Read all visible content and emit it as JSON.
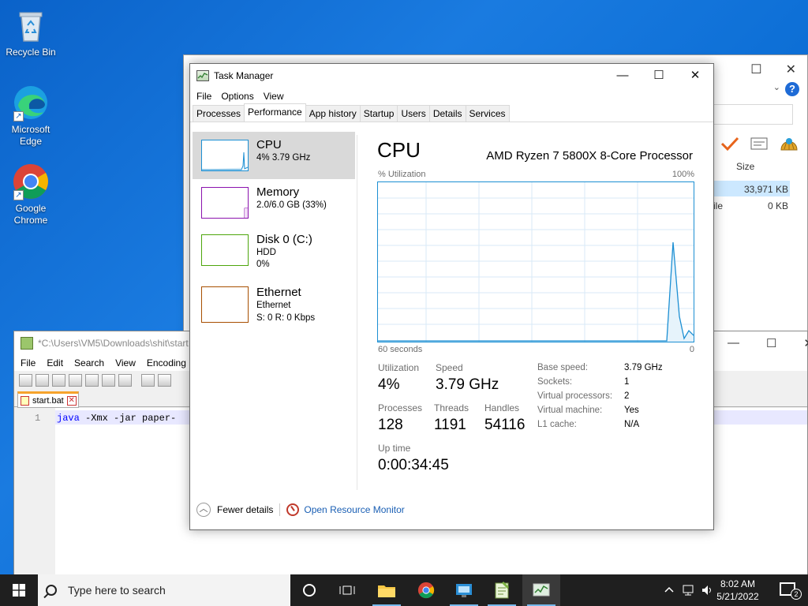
{
  "desktop": {
    "icons": [
      {
        "label": "Recycle Bin",
        "icon": "recycle-bin-icon"
      },
      {
        "label": "Microsoft Edge",
        "icon": "edge-icon"
      },
      {
        "label": "Google Chrome",
        "icon": "chrome-icon"
      }
    ]
  },
  "explorer": {
    "size_header": "Size",
    "row1_size": "33,971 KB",
    "row2_partial": "ile",
    "row2_size": "0 KB"
  },
  "notepad": {
    "title": "*C:\\Users\\VM5\\Downloads\\shit\\start",
    "menu": [
      "File",
      "Edit",
      "Search",
      "View",
      "Encoding"
    ],
    "tab_label": "start.bat",
    "line_number": "1",
    "code_kw": "java",
    "code_rest": " -Xmx -jar paper-"
  },
  "taskmanager": {
    "title": "Task Manager",
    "menu": [
      "File",
      "Options",
      "View"
    ],
    "tabs": [
      "Processes",
      "Performance",
      "App history",
      "Startup",
      "Users",
      "Details",
      "Services"
    ],
    "active_tab": "Performance",
    "resources": [
      {
        "name": "CPU",
        "line1": "4% 3.79 GHz",
        "line2": "",
        "color": "#1c8fd3"
      },
      {
        "name": "Memory",
        "line1": "2.0/6.0 GB (33%)",
        "line2": "",
        "color": "#8b12ae"
      },
      {
        "name": "Disk 0 (C:)",
        "line1": "HDD",
        "line2": "0%",
        "color": "#4da60c"
      },
      {
        "name": "Ethernet",
        "line1": "Ethernet",
        "line2": "S: 0 R: 0 Kbps",
        "color": "#a74f01"
      }
    ],
    "cpu": {
      "title": "CPU",
      "model": "AMD Ryzen 7 5800X 8-Core Processor",
      "util_label": "% Utilization",
      "util_max": "100%",
      "time_label": "60 seconds",
      "time_zero": "0",
      "stats": {
        "utilization_label": "Utilization",
        "utilization": "4%",
        "speed_label": "Speed",
        "speed": "3.79 GHz",
        "processes_label": "Processes",
        "processes": "128",
        "threads_label": "Threads",
        "threads": "1191",
        "handles_label": "Handles",
        "handles": "54116",
        "uptime_label": "Up time",
        "uptime": "0:00:34:45"
      },
      "specs": [
        {
          "label": "Base speed:",
          "value": "3.79 GHz"
        },
        {
          "label": "Sockets:",
          "value": "1"
        },
        {
          "label": "Virtual processors:",
          "value": "2"
        },
        {
          "label": "Virtual machine:",
          "value": "Yes"
        },
        {
          "label": "L1 cache:",
          "value": "N/A"
        }
      ]
    },
    "footer": {
      "fewer_details": "Fewer details",
      "resource_monitor": "Open Resource Monitor"
    }
  },
  "taskbar": {
    "search_placeholder": "Type here to search",
    "time": "8:02 AM",
    "date": "5/21/2022",
    "notification_count": "2"
  }
}
